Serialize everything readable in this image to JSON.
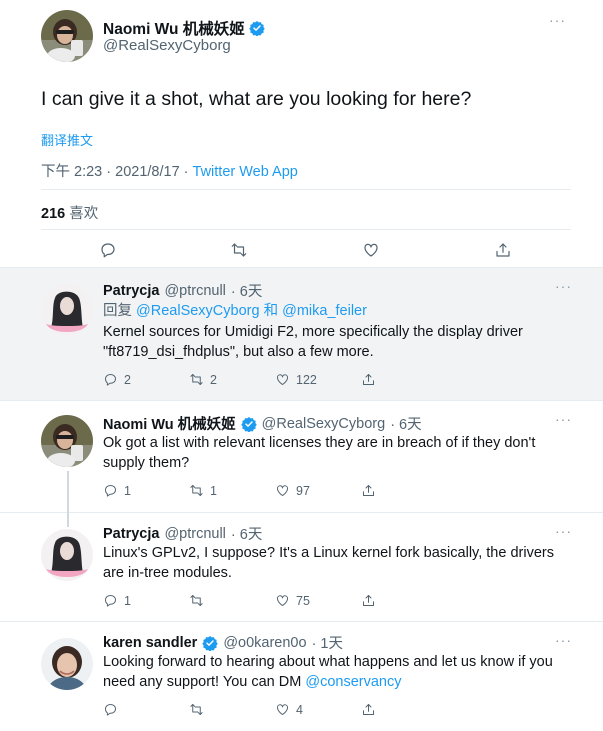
{
  "main_tweet": {
    "display_name": "Naomi Wu 机械妖姬",
    "handle": "@RealSexyCyborg",
    "text": "I can give it a shot, what are you looking for here?",
    "translate_label": "翻译推文",
    "time": "下午 2:23 · 2021/8/17 · ",
    "source": "Twitter Web App",
    "like_count": "216",
    "like_label": "喜欢",
    "more": "···"
  },
  "replies": [
    {
      "display_name": "Patrycja",
      "handle": "@ptrcnull",
      "age": "· 6天",
      "reply_prefix": "回复 ",
      "reply_to_1": "@RealSexyCyborg",
      "reply_joiner": " 和 ",
      "reply_to_2": "@mika_feiler",
      "text": "Kernel sources for Umidigi F2, more specifically the display driver \"ft8719_dsi_fhdplus\", but also a few more.",
      "reply_count": "2",
      "retweet_count": "2",
      "like_count": "122",
      "more": "···"
    },
    {
      "display_name": "Naomi Wu 机械妖姬",
      "handle": "@RealSexyCyborg",
      "age": "· 6天",
      "text": "Ok got a list with relevant licenses they are in breach of if they don't supply them?",
      "reply_count": "1",
      "retweet_count": "1",
      "like_count": "97",
      "more": "···"
    },
    {
      "display_name": "Patrycja",
      "handle": "@ptrcnull",
      "age": "· 6天",
      "text": "Linux's GPLv2, I suppose? It's a Linux kernel fork basically, the drivers are in-tree modules.",
      "reply_count": "1",
      "retweet_count": "",
      "like_count": "75",
      "more": "···"
    },
    {
      "display_name": "karen sandler",
      "handle": "@o0karen0o",
      "age": "· 1天",
      "text_before": "Looking forward to hearing about what happens and let us know if you need any support! You can DM ",
      "mention": "@conservancy",
      "reply_count": "",
      "retweet_count": "",
      "like_count": "4",
      "more": "···"
    }
  ],
  "icons": [
    "reply-icon",
    "retweet-icon",
    "like-icon",
    "share-icon",
    "verified-icon"
  ],
  "colors": {
    "accent": "#1d9bf0",
    "muted": "#536471",
    "highlight_bg": "#f2f3f5"
  }
}
